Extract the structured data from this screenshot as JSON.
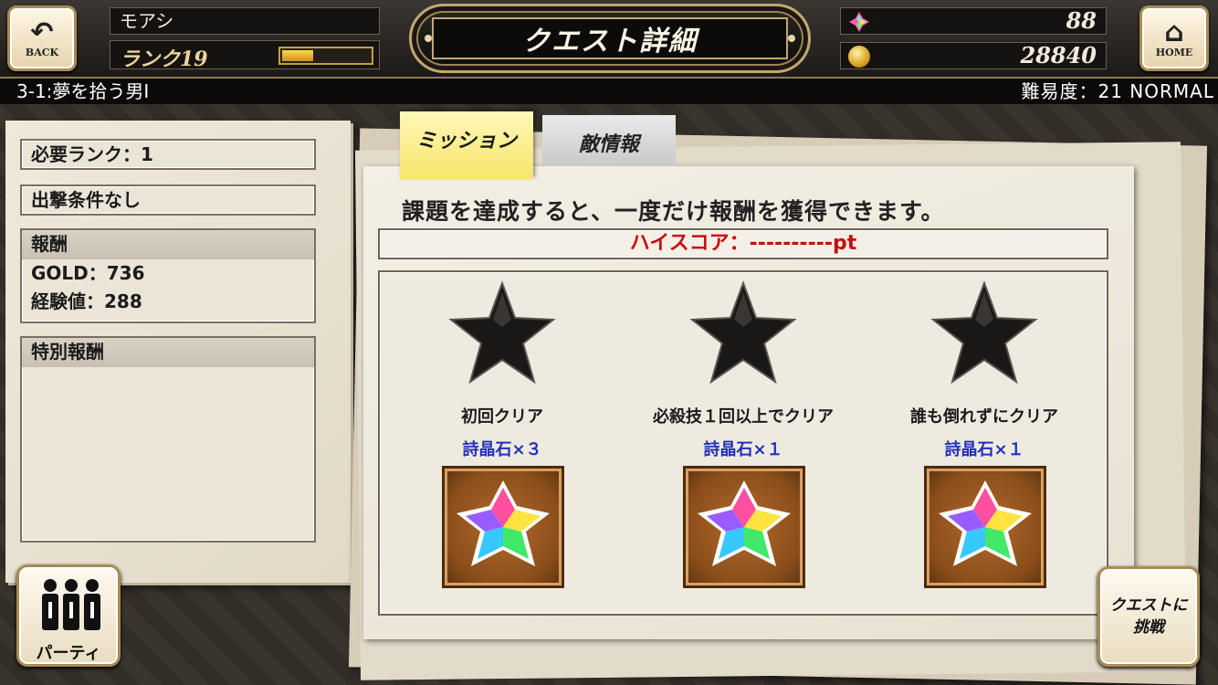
{
  "header": {
    "back_label": "BACK",
    "home_label": "HOME",
    "player_name": "モアシ",
    "rank_label": "ランク19",
    "rank_progress": 0.35,
    "title": "クエスト詳細",
    "gems": "88",
    "gold": "28840"
  },
  "subheader": {
    "stage": "3-1:夢を拾う男Ⅰ",
    "difficulty": "難易度：21 NORMAL"
  },
  "left_panel": {
    "required_rank": "必要ランク：1",
    "condition": "出撃条件なし",
    "reward_title": "報酬",
    "reward_gold": "GOLD：736",
    "reward_exp": "経験値：288",
    "special_title": "特別報酬"
  },
  "tabs": {
    "mission": "ミッション",
    "enemy": "敵情報"
  },
  "main": {
    "intro": "課題を達成すると、一度だけ報酬を獲得できます。",
    "high_score": "ハイスコア：----------pt",
    "missions": [
      {
        "title": "初回クリア",
        "reward": "詩晶石×３",
        "icon": "star-icon"
      },
      {
        "title": "必殺技１回以上でクリア",
        "reward": "詩晶石×１",
        "icon": "star-icon"
      },
      {
        "title": "誰も倒れずにクリア",
        "reward": "詩晶石×１",
        "icon": "star-icon"
      }
    ]
  },
  "buttons": {
    "party": "パーティ",
    "challenge": "クエストに挑戦"
  },
  "colors": {
    "accent_gold": "#c2a670",
    "score_red": "#c70f0f",
    "reward_blue": "#2431b8",
    "tab_yellow": "#f7e56a"
  }
}
